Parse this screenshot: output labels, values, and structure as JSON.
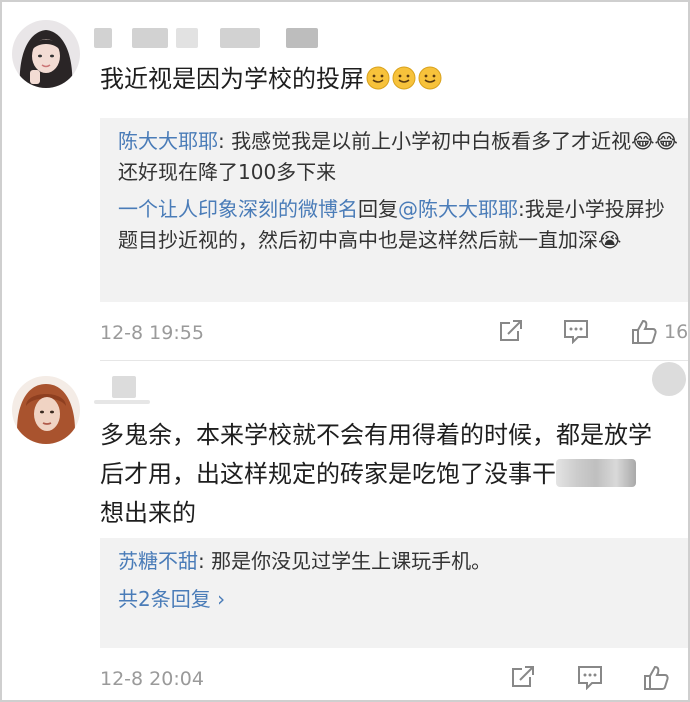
{
  "comments": [
    {
      "text": "我近视是因为学校的投屏",
      "emojis": [
        "smile-emoji",
        "smile-emoji",
        "smile-emoji"
      ],
      "replies": [
        {
          "author": "陈大大耶耶",
          "sep": ": ",
          "text": "我感觉我是以前上小学初中白板看多了才近视😂😂还好现在降了100多下来"
        },
        {
          "author": "一个让人印象深刻的微博名",
          "mid": "回复",
          "at": "@陈大大耶耶",
          "sep": ":",
          "text": "我是小学投屏抄题目抄近视的，然后初中高中也是这样然后就一直加深😭"
        }
      ],
      "time": "12-8 19:55",
      "likes": "16"
    },
    {
      "text_before": "多鬼余，本来学校就不会有用得着的时候，都是放学后才用，出这样规定的砖家是吃饱了没事干",
      "text_after": "想出来的",
      "replies": [
        {
          "author": "苏糖不甜",
          "sep": ": ",
          "text": "那是你没见过学生上课玩手机。"
        }
      ],
      "more_replies": "共2条回复 ›",
      "time": "12-8 20:04"
    }
  ],
  "icons": [
    "repost-icon",
    "comment-icon",
    "thumbs-up-icon",
    "smile-emoji"
  ],
  "colors": {
    "link": "#4a7cb8",
    "meta": "#9a9a9a",
    "reply_bg": "#f2f2f2"
  }
}
